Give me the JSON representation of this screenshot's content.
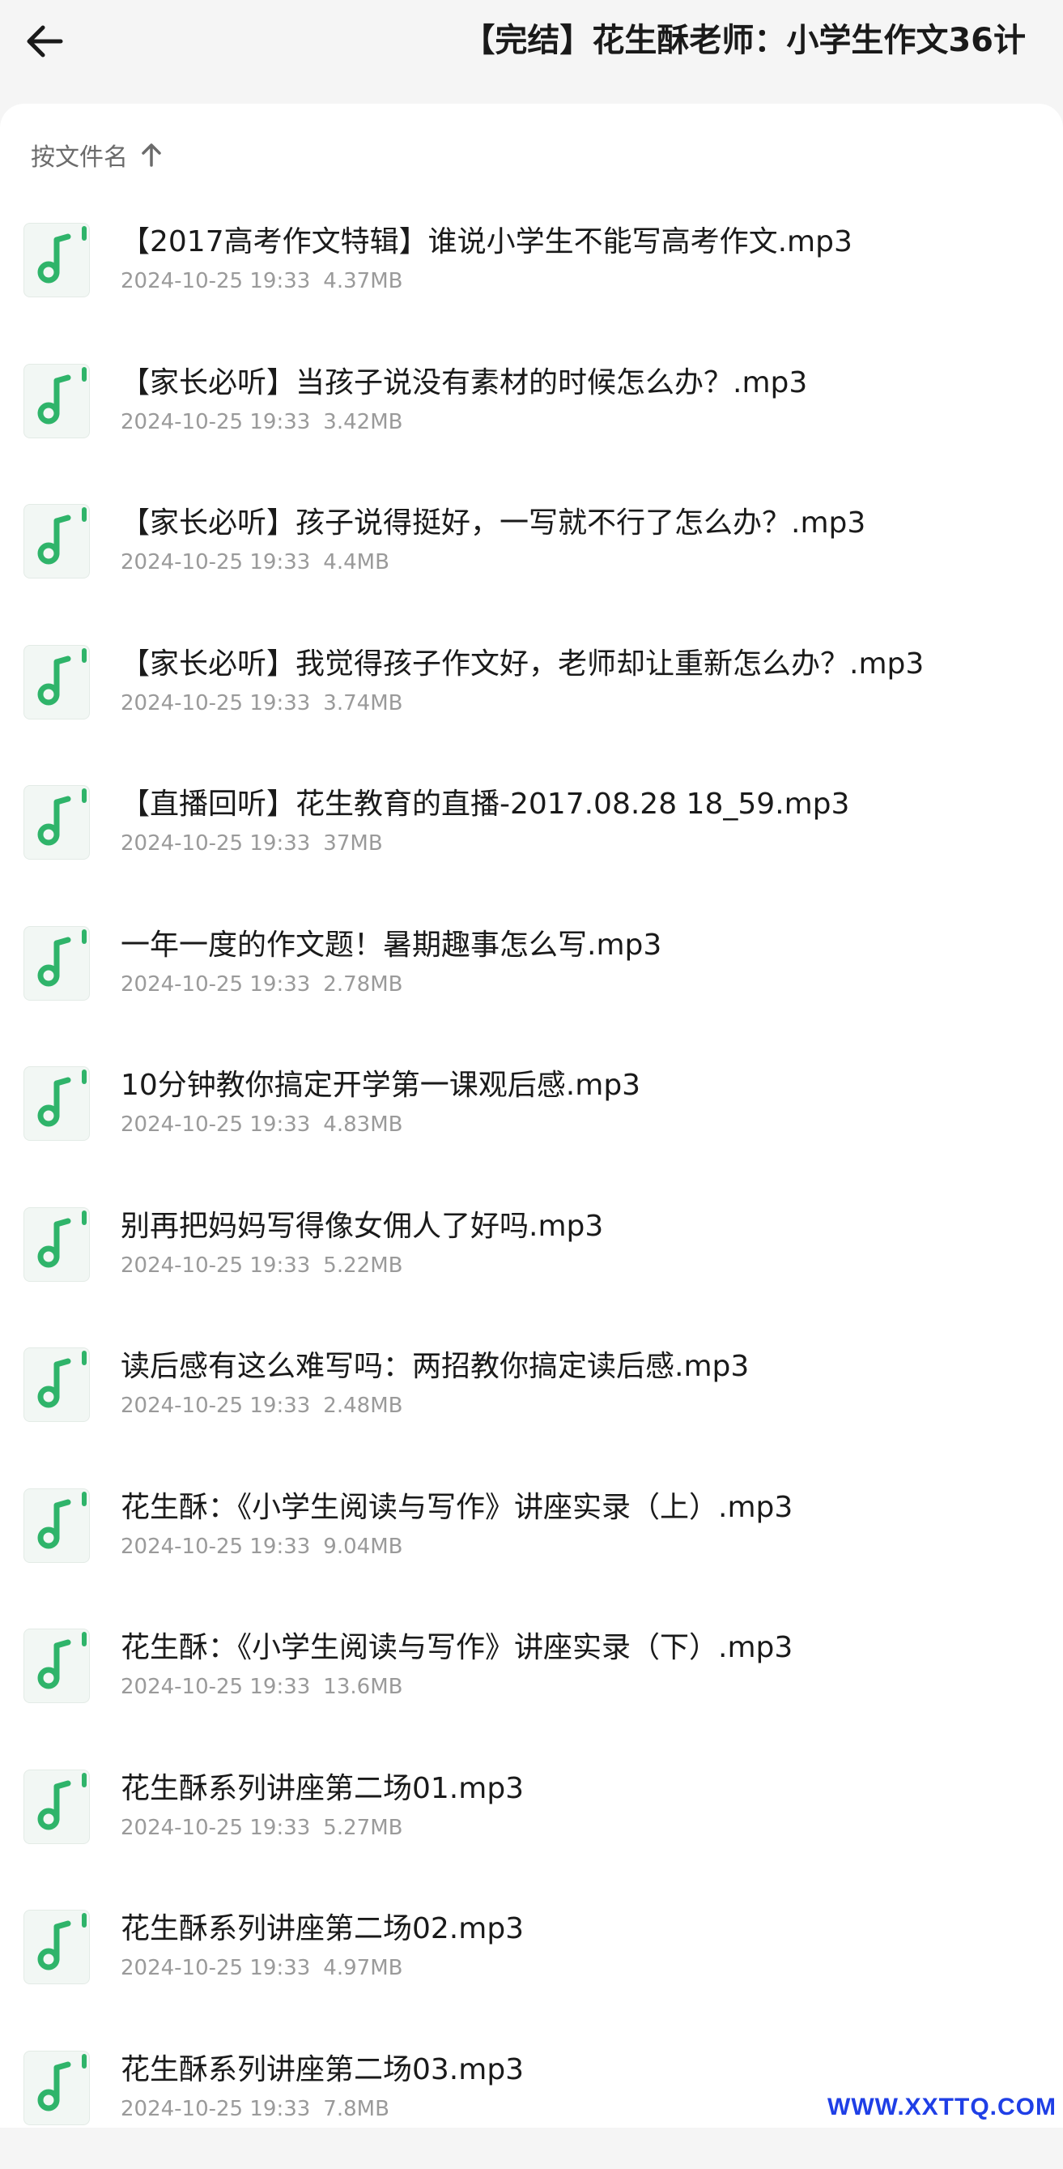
{
  "header": {
    "title": "【完结】花生酥老师：小学生作文36计"
  },
  "sort": {
    "label": "按文件名"
  },
  "files": [
    {
      "name": "【2017高考作文特辑】谁说小学生不能写高考作文.mp3",
      "date": "2024-10-25 19:33",
      "size": "4.37MB"
    },
    {
      "name": "【家长必听】当孩子说没有素材的时候怎么办？.mp3",
      "date": "2024-10-25 19:33",
      "size": "3.42MB"
    },
    {
      "name": "【家长必听】孩子说得挺好，一写就不行了怎么办？.mp3",
      "date": "2024-10-25 19:33",
      "size": "4.4MB"
    },
    {
      "name": "【家长必听】我觉得孩子作文好，老师却让重新怎么办？.mp3",
      "date": "2024-10-25 19:33",
      "size": "3.74MB"
    },
    {
      "name": "【直播回听】花生教育的直播-2017.08.28 18_59.mp3",
      "date": "2024-10-25 19:33",
      "size": "37MB"
    },
    {
      "name": "一年一度的作文题！暑期趣事怎么写.mp3",
      "date": "2024-10-25 19:33",
      "size": "2.78MB"
    },
    {
      "name": "10分钟教你搞定开学第一课观后感.mp3",
      "date": "2024-10-25 19:33",
      "size": "4.83MB"
    },
    {
      "name": "别再把妈妈写得像女佣人了好吗.mp3",
      "date": "2024-10-25 19:33",
      "size": "5.22MB"
    },
    {
      "name": "读后感有这么难写吗：两招教你搞定读后感.mp3",
      "date": "2024-10-25 19:33",
      "size": "2.48MB"
    },
    {
      "name": "花生酥：《小学生阅读与写作》讲座实录（上）.mp3",
      "date": "2024-10-25 19:33",
      "size": "9.04MB"
    },
    {
      "name": "花生酥：《小学生阅读与写作》讲座实录（下）.mp3",
      "date": "2024-10-25 19:33",
      "size": "13.6MB"
    },
    {
      "name": "花生酥系列讲座第二场01.mp3",
      "date": "2024-10-25 19:33",
      "size": "5.27MB"
    },
    {
      "name": "花生酥系列讲座第二场02.mp3",
      "date": "2024-10-25 19:33",
      "size": "4.97MB"
    },
    {
      "name": "花生酥系列讲座第二场03.mp3",
      "date": "2024-10-25 19:33",
      "size": "7.8MB"
    }
  ],
  "icons": {
    "back": "arrow-left-icon",
    "sort": "arrow-up-icon",
    "file": "music-note-icon"
  },
  "colors": {
    "accent": "#2fb46a",
    "watermark": "#1f3fe6"
  },
  "watermark": "WWW.XXTTQ.COM"
}
